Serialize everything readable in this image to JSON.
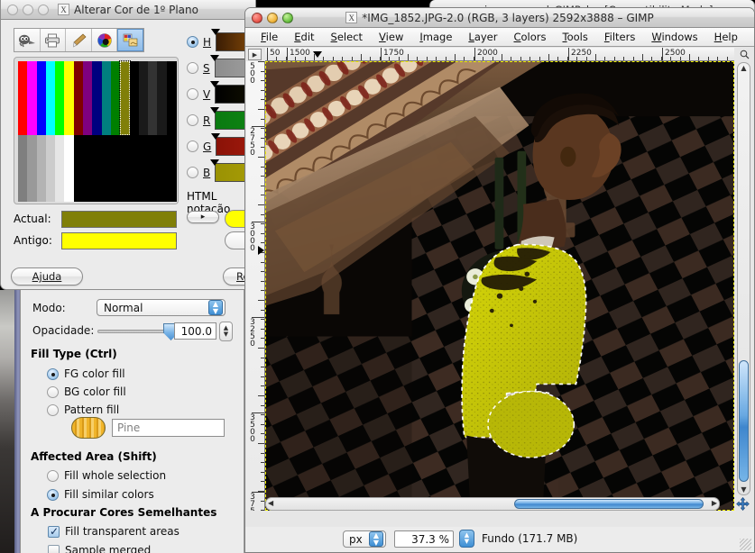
{
  "background_window": {
    "title": "guia_e_manual_GIMP.doc [Compatibility Mode]"
  },
  "color_dialog": {
    "title": "Alterar Cor de 1º Plano",
    "window_icon": "x-window-icon",
    "toolbar_icons": [
      "wilber-icon",
      "printer-icon",
      "paintbrush-icon",
      "color-wheel-icon",
      "image-palette-icon"
    ],
    "channels": [
      {
        "key": "H",
        "label": "H",
        "selected": true,
        "gradient": "linear-gradient(to right,#3a1d05,#6d3b06,#8d6b08,#b6a60a)"
      },
      {
        "key": "S",
        "label": "S",
        "selected": false,
        "gradient": "linear-gradient(to right,#8d8d8d,#9e9e9e,#d0d0d0)"
      },
      {
        "key": "V",
        "label": "V",
        "selected": false,
        "gradient": "linear-gradient(to right,#000000,#111000,#2b2702)"
      },
      {
        "key": "R",
        "label": "R",
        "selected": false,
        "gradient": "linear-gradient(to right,#0a7a10,#0f8414,#149018)"
      },
      {
        "key": "G",
        "label": "G",
        "selected": false,
        "gradient": "linear-gradient(to right,#8a1208,#a01a0b,#b5240e)"
      },
      {
        "key": "B",
        "label": "B",
        "selected": false,
        "gradient": "linear-gradient(to right,#9a9204,#a79c06,#b0a608)"
      }
    ],
    "html_notation_label": "HTML notação",
    "current_label": "Actual:",
    "current_color": "#807f08",
    "old_label": "Antigo:",
    "old_color": "#ffff00",
    "help_button": "Ajuda",
    "reset_button": "Re",
    "arrow_button": "▸",
    "palette": {
      "top_row_colors": [
        "#ff0000",
        "#ff00ff",
        "#0000ff",
        "#00ffff",
        "#00ff00",
        "#ffff00",
        "#7f0000",
        "#7f007f",
        "#00007f",
        "#007f7f",
        "#007f00",
        "#807f08",
        "#000000",
        "#1a1a1a",
        "#333333",
        "#1a1a1a",
        "#000000"
      ],
      "bottom_row_colors": [
        "#7f7f7f",
        "#999999",
        "#b3b3b3",
        "#cccccc",
        "#e6e6e6",
        "#ffffff",
        "#000000"
      ],
      "selected_index": 11
    }
  },
  "tool_options": {
    "mode_label": "Modo:",
    "mode_value": "Normal",
    "opacity_label": "Opacidade:",
    "opacity_value": "100.0",
    "opacity_percent": 100,
    "fill_type_header": "Fill Type  (Ctrl)",
    "fill_type_options": [
      {
        "label": "FG color fill",
        "selected": true
      },
      {
        "label": "BG color fill",
        "selected": false
      },
      {
        "label": "Pattern fill",
        "selected": false
      }
    ],
    "pattern_name": "Pine",
    "affected_area_header": "Affected Area  (Shift)",
    "affected_area_options": [
      {
        "label": "Fill whole selection",
        "selected": false
      },
      {
        "label": "Fill similar colors",
        "selected": true
      }
    ],
    "find_similar_header": "A Procurar Cores Semelhantes",
    "checkboxes": [
      {
        "label": "Fill transparent areas",
        "checked": true
      },
      {
        "label": "Sample merged",
        "checked": false
      }
    ]
  },
  "gimp_window": {
    "title": "*IMG_1852.JPG-2.0 (RGB, 3 layers) 2592x3888 – GIMP",
    "window_icon": "x-window-icon",
    "menus": [
      "File",
      "Edit",
      "Select",
      "View",
      "Image",
      "Layer",
      "Colors",
      "Tools",
      "Filters",
      "Windows",
      "Help"
    ],
    "ruler_h_labels": [
      "50",
      "1500",
      "1750",
      "2000",
      "2250",
      "2500"
    ],
    "ruler_v_labels": [
      "2500",
      "2750",
      "3000",
      "3250",
      "3500",
      "3750"
    ],
    "unit_value": "px",
    "zoom_value": "37.3 %",
    "layer_status": "Fundo (171.7 MB)",
    "zoom_icon": "magnifier-icon",
    "navigate_icon": "move-cross-icon",
    "ruler_origin_icon": "ruler-origin-icon"
  }
}
